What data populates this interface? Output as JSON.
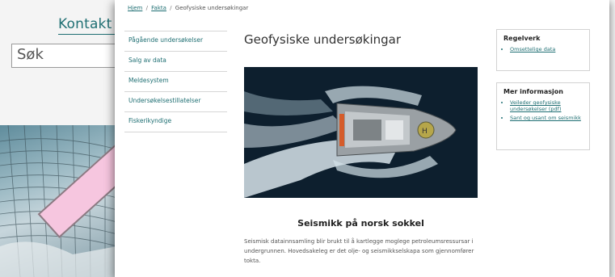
{
  "background": {
    "contact_link": "Kontakt o",
    "search_placeholder": "Søk"
  },
  "breadcrumb": {
    "home": "Hjem",
    "sep1": "/",
    "facts": "Fakta",
    "sep2": "/",
    "current": "Geofysiske undersøkingar"
  },
  "sidebar": {
    "items": [
      {
        "label": "Pågående undersøkelser"
      },
      {
        "label": "Salg av data"
      },
      {
        "label": "Meldesystem"
      },
      {
        "label": "Undersøkelsestillatelser"
      },
      {
        "label": "Fiskerikyndige"
      }
    ]
  },
  "main": {
    "title": "Geofysiske undersøkingar",
    "section_title": "Seismikk på norsk sokkel",
    "body_text": "Seismisk datainnsamling blir brukt til å kartlegge moglege petroleumsressursar i undergrunnen. Hovedsakeleg er det olje- og seismikkselskapa som gjennomfører tokta."
  },
  "aside": {
    "regelverk": {
      "title": "Regelverk",
      "links": [
        "Omsettelige data"
      ]
    },
    "mer_informasjon": {
      "title": "Mer informasjon",
      "links": [
        "Veileder geofysiske undersøkelser (pdf)",
        "Sant og usant om seismikk"
      ]
    }
  },
  "colors": {
    "accent": "#1f6f73",
    "annotation_arrow": "#f6c6df"
  }
}
